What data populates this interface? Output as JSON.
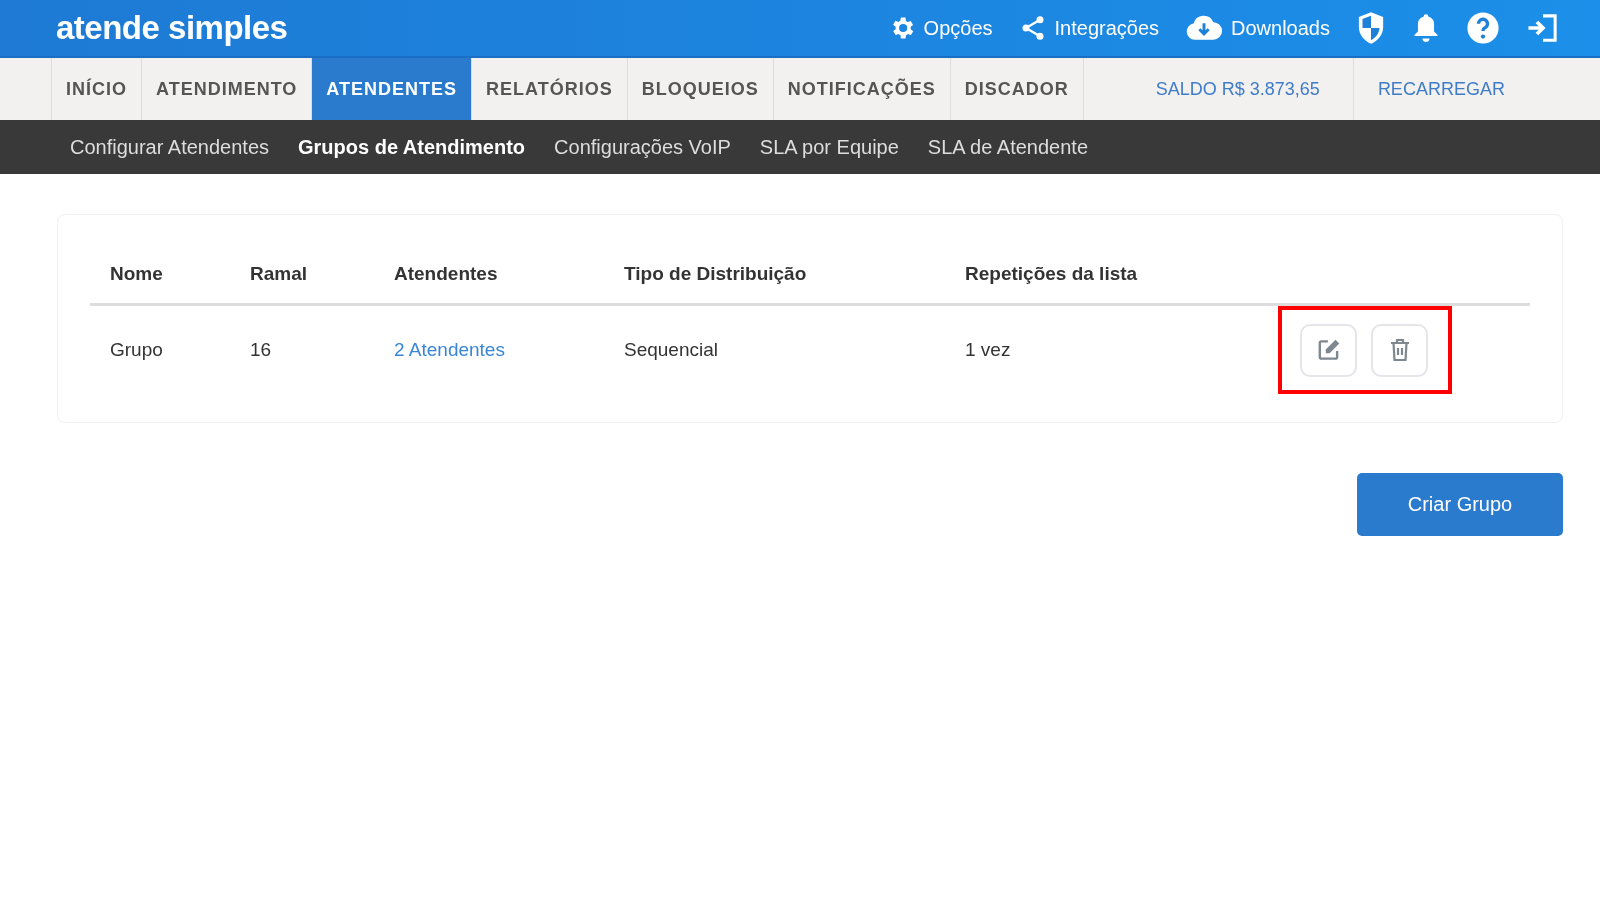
{
  "header": {
    "logo": "atende simples",
    "links": [
      {
        "kind": "gear",
        "label": "Opções"
      },
      {
        "kind": "share",
        "label": "Integrações"
      },
      {
        "kind": "cloud",
        "label": "Downloads"
      }
    ],
    "icons": [
      {
        "kind": "shield"
      },
      {
        "kind": "bell"
      },
      {
        "kind": "help"
      },
      {
        "kind": "logout"
      }
    ]
  },
  "tabs": [
    {
      "label": "INÍCIO",
      "selected": false
    },
    {
      "label": "ATENDIMENTO",
      "selected": false
    },
    {
      "label": "ATENDENTES",
      "selected": true
    },
    {
      "label": "RELATÓRIOS",
      "selected": false
    },
    {
      "label": "BLOQUEIOS",
      "selected": false
    },
    {
      "label": "NOTIFICAÇÕES",
      "selected": false
    },
    {
      "label": "DISCADOR",
      "selected": false
    }
  ],
  "balance": "SALDO R$ 3.873,65",
  "recharge": "RECARREGAR",
  "subtabs": [
    {
      "label": "Configurar Atendentes",
      "selected": false
    },
    {
      "label": "Grupos de Atendimento",
      "selected": true
    },
    {
      "label": "Configurações VoIP",
      "selected": false
    },
    {
      "label": "SLA por Equipe",
      "selected": false
    },
    {
      "label": "SLA de Atendente",
      "selected": false
    }
  ],
  "table": {
    "columns": [
      "Nome",
      "Ramal",
      "Atendentes",
      "Tipo de Distribuição",
      "Repetições da lista"
    ],
    "rows": [
      {
        "name": "Grupo",
        "extension": "16",
        "agents": "2 Atendentes",
        "distribution": "Sequencial",
        "repetitions": "1 vez",
        "highlighted": true
      }
    ]
  },
  "create_button": "Criar Grupo"
}
